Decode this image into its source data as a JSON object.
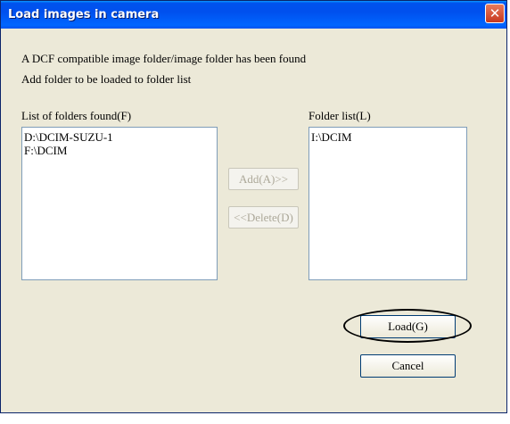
{
  "window": {
    "title": "Load images in camera"
  },
  "title_bar": {
    "close_glyph": "✕"
  },
  "message": {
    "line1": "A DCF compatible image folder/image folder has been found",
    "line2": "Add folder to be loaded to folder list"
  },
  "found_list": {
    "label": "List of folders found(F)",
    "items": [
      "D:\\DCIM-SUZU-1",
      "F:\\DCIM"
    ]
  },
  "folder_list": {
    "label": "Folder list(L)",
    "items": [
      "I:\\DCIM"
    ]
  },
  "buttons": {
    "add": "Add(A)>>",
    "delete": "<<Delete(D)",
    "load": "Load(G)",
    "cancel": "Cancel"
  }
}
